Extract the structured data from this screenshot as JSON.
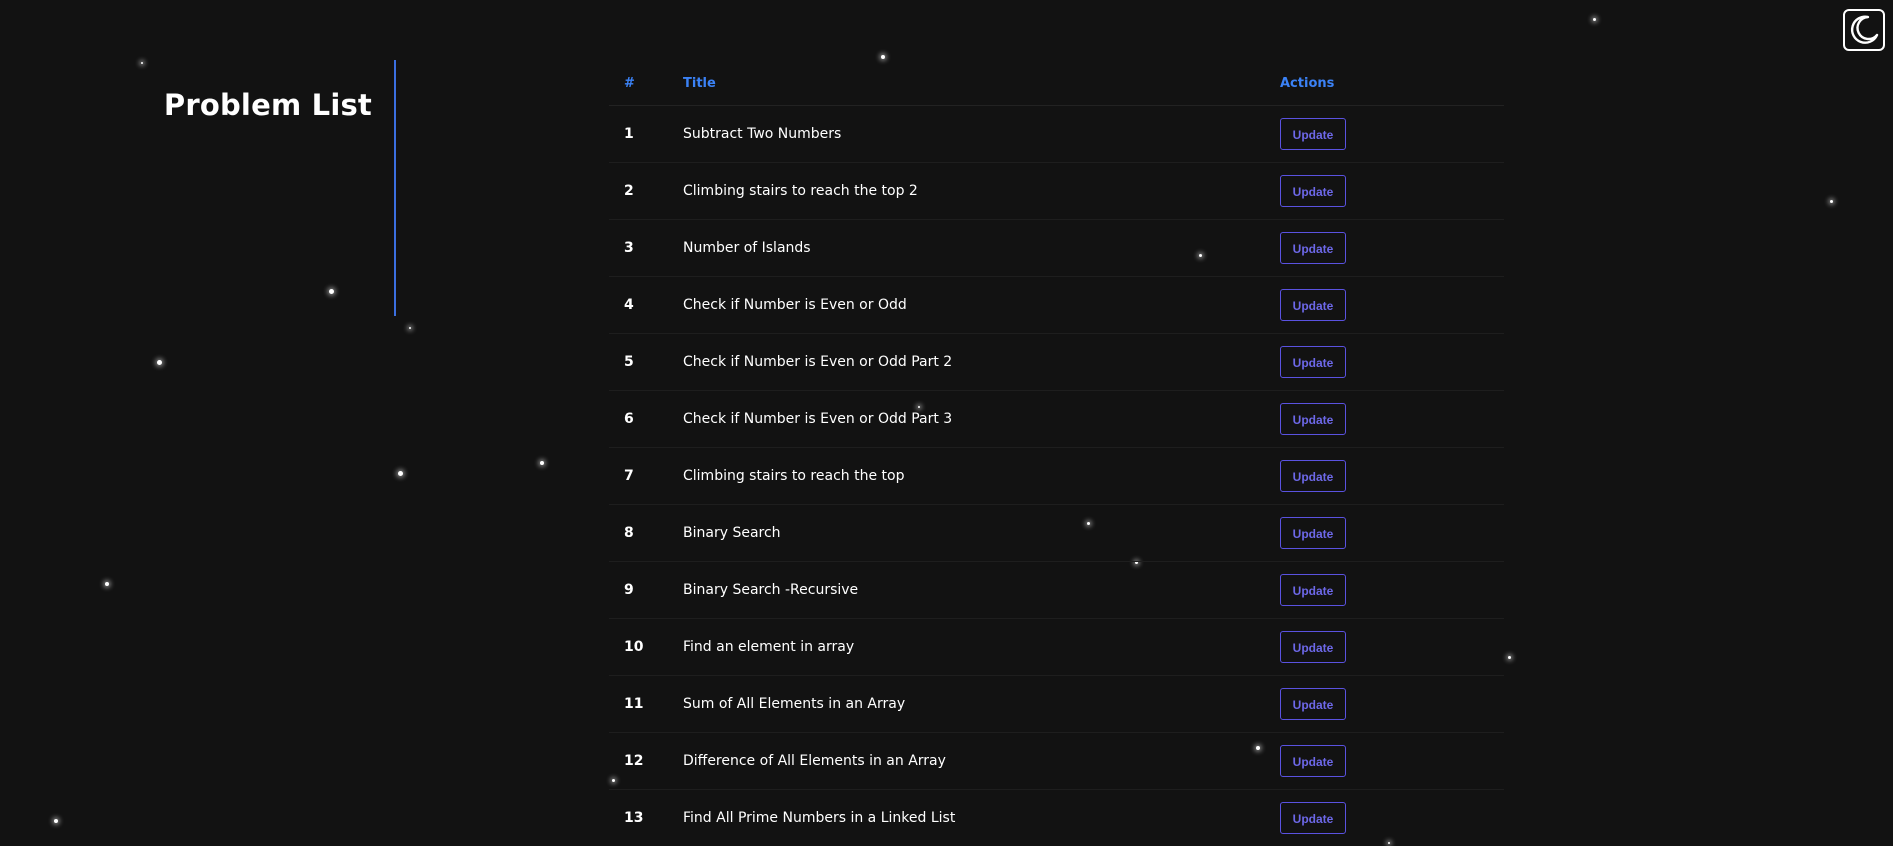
{
  "sidebar": {
    "title": "Problem List"
  },
  "table": {
    "headers": {
      "number": "#",
      "title": "Title",
      "actions": "Actions"
    },
    "rows": [
      {
        "number": "1",
        "title": "Subtract Two Numbers",
        "action": "Update"
      },
      {
        "number": "2",
        "title": "Climbing stairs to reach the top 2",
        "action": "Update"
      },
      {
        "number": "3",
        "title": "Number of Islands",
        "action": "Update"
      },
      {
        "number": "4",
        "title": "Check if Number is Even or Odd",
        "action": "Update"
      },
      {
        "number": "5",
        "title": "Check if Number is Even or Odd Part 2",
        "action": "Update"
      },
      {
        "number": "6",
        "title": "Check if Number is Even or Odd Part 3",
        "action": "Update"
      },
      {
        "number": "7",
        "title": "Climbing stairs to reach the top",
        "action": "Update"
      },
      {
        "number": "8",
        "title": "Binary Search",
        "action": "Update"
      },
      {
        "number": "9",
        "title": "Binary Search -Recursive",
        "action": "Update"
      },
      {
        "number": "10",
        "title": "Find an element in array",
        "action": "Update"
      },
      {
        "number": "11",
        "title": "Sum of All Elements in an Array",
        "action": "Update"
      },
      {
        "number": "12",
        "title": "Difference of All Elements in an Array",
        "action": "Update"
      },
      {
        "number": "13",
        "title": "Find All Prime Numbers in a Linked List",
        "action": "Update"
      }
    ]
  },
  "theme_toggle": {
    "icon": "moon-icon"
  },
  "colors": {
    "background": "#121212",
    "accent_blue": "#3b82f6",
    "divider": "#3b6fe0",
    "button_border": "#5a52e0",
    "button_text": "#6d68e8"
  }
}
